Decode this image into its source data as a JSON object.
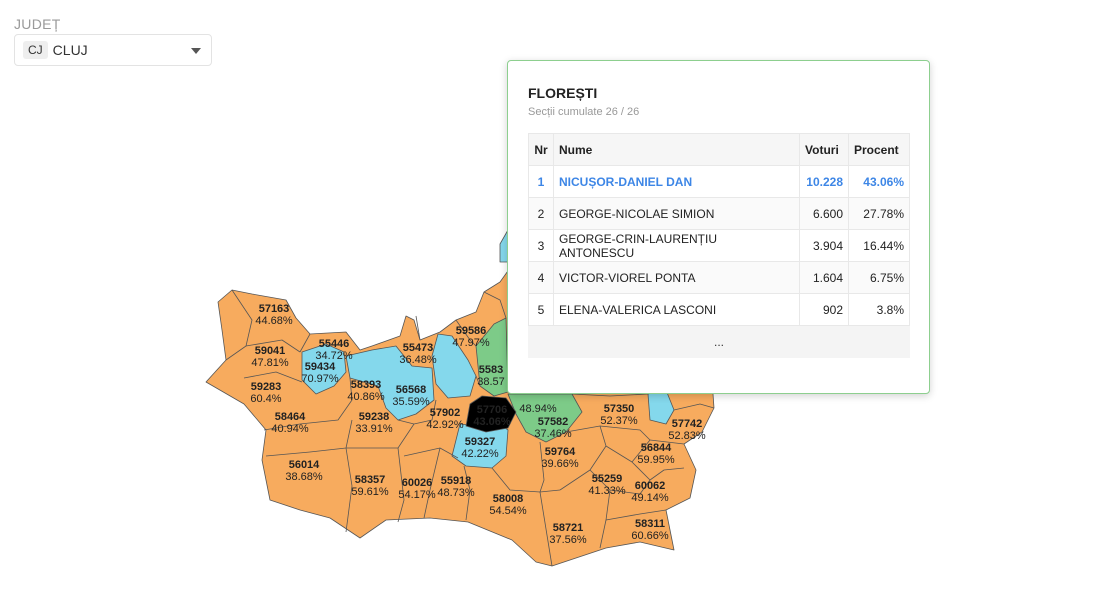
{
  "county": {
    "label": "JUDEȚ",
    "code": "CJ",
    "name": "CLUJ"
  },
  "map": {
    "colors": {
      "orange": "#f7ab5e",
      "blue": "#84d8ec",
      "green": "#7dcb88",
      "selected": "#000000",
      "border": "#555555"
    },
    "labels": [
      {
        "code": "57163",
        "pct": "44.68%"
      },
      {
        "code": "55446",
        "pct": "34.72%"
      },
      {
        "code": "59041",
        "pct": "47.81%"
      },
      {
        "code": "59434",
        "pct": "70.97%"
      },
      {
        "code": "55473",
        "pct": "36.48%"
      },
      {
        "code": "59586",
        "pct": "47.97%"
      },
      {
        "code": "5583",
        "pct": "38.57"
      },
      {
        "code": "59283",
        "pct": "60.4%"
      },
      {
        "code": "58393",
        "pct": "40.86%"
      },
      {
        "code": "56568",
        "pct": "35.59%"
      },
      {
        "code": "58464",
        "pct": "40.94%"
      },
      {
        "code": "59238",
        "pct": "33.91%"
      },
      {
        "code": "57902",
        "pct": "42.92%"
      },
      {
        "code": "57706",
        "pct": "43.06%"
      },
      {
        "code": "57582",
        "pct": "37.46%"
      },
      {
        "code": "57350",
        "pct": "52.37%"
      },
      {
        "code": "57742",
        "pct": "52.83%"
      },
      {
        "code": "59327",
        "pct": "42.22%"
      },
      {
        "code": "56844",
        "pct": "59.95%"
      },
      {
        "code": "59764",
        "pct": "39.66%"
      },
      {
        "code": "56014",
        "pct": "38.68%"
      },
      {
        "code": "58357",
        "pct": "59.61%"
      },
      {
        "code": "60026",
        "pct": "54.17%"
      },
      {
        "code": "55918",
        "pct": "48.73%"
      },
      {
        "code": "55259",
        "pct": "41.33%"
      },
      {
        "code": "60062",
        "pct": "49.14%"
      },
      {
        "code": "58008",
        "pct": "54.54%"
      },
      {
        "code": "58721",
        "pct": "37.56%"
      },
      {
        "code": "58311",
        "pct": "60.66%"
      },
      {
        "code": "",
        "pct": "48.94%"
      }
    ]
  },
  "popup": {
    "title": "FLOREȘTI",
    "subtitle": "Secții cumulate 26 / 26",
    "headers": {
      "nr": "Nr",
      "name": "Nume",
      "votes": "Voturi",
      "percent": "Procent"
    },
    "rows": [
      {
        "nr": "1",
        "name": "NICUȘOR-DANIEL DAN",
        "votes": "10.228",
        "percent": "43.06%"
      },
      {
        "nr": "2",
        "name": "GEORGE-NICOLAE SIMION",
        "votes": "6.600",
        "percent": "27.78%"
      },
      {
        "nr": "3",
        "name": "GEORGE-CRIN-LAURENȚIU ANTONESCU",
        "votes": "3.904",
        "percent": "16.44%"
      },
      {
        "nr": "4",
        "name": "VICTOR-VIOREL PONTA",
        "votes": "1.604",
        "percent": "6.75%"
      },
      {
        "nr": "5",
        "name": "ELENA-VALERICA LASCONI",
        "votes": "902",
        "percent": "3.8%"
      }
    ],
    "more": "..."
  }
}
